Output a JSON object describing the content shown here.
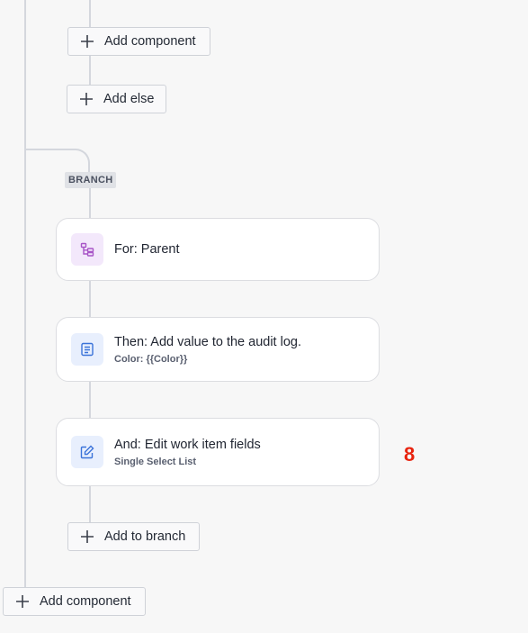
{
  "buttons": {
    "add_component_top": "Add component",
    "add_else": "Add else",
    "add_to_branch": "Add to branch",
    "add_component_bottom": "Add component"
  },
  "branch_badge": "BRANCH",
  "cards": [
    {
      "title": "For: Parent",
      "subtitle": "",
      "icon": "hierarchy-icon",
      "icon_color": "#a855c7",
      "icon_bg": "#f3e8fb"
    },
    {
      "title": "Then: Add value to the audit log.",
      "subtitle": "Color: {{Color}}",
      "icon": "document-icon",
      "icon_color": "#3b73d9",
      "icon_bg": "#e8effd"
    },
    {
      "title": "And: Edit work item fields",
      "subtitle": "Single Select List",
      "icon": "edit-icon",
      "icon_color": "#3b73d9",
      "icon_bg": "#e8effd"
    }
  ],
  "marker_label": "8",
  "colors": {
    "connector": "#d4d7dd",
    "marker": "#e8240f"
  }
}
